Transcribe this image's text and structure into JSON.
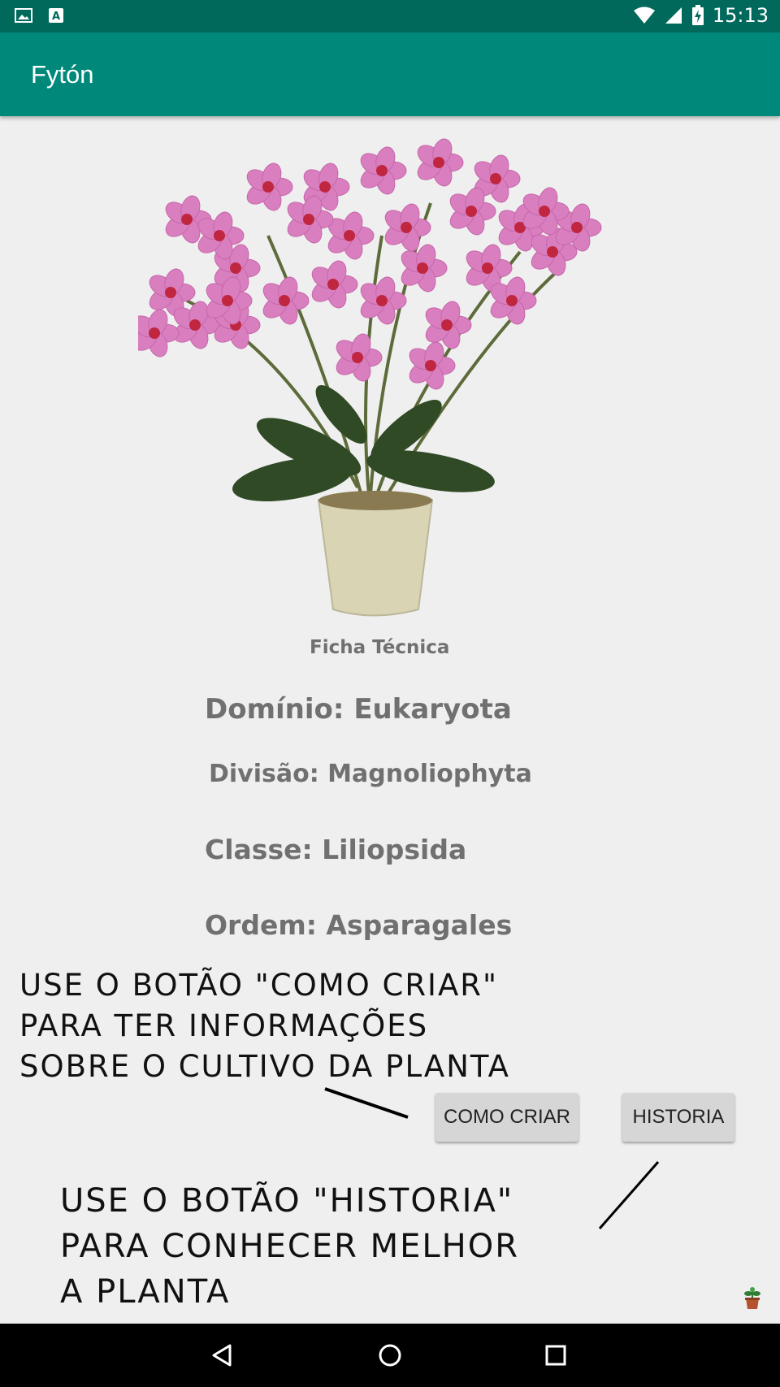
{
  "status_bar": {
    "time": "15:13",
    "left_icons": [
      "image-icon",
      "text-a-icon"
    ],
    "right_icons": [
      "wifi-icon",
      "cellular-signal-icon",
      "battery-icon"
    ]
  },
  "app_bar": {
    "title": "Fytón"
  },
  "plant": {
    "image_icon": "orchid-plant-image",
    "ficha_title": "Ficha Técnica",
    "dominio": "Domínio: Eukaryota",
    "divisao": "Divisão: Magnoliophyta",
    "classe": "Classe: Liliopsida",
    "ordem": "Ordem: Asparagales"
  },
  "annotations": {
    "como_criar": [
      "USE O BOTÃO \"COMO CRIAR\"",
      "PARA TER INFORMAÇÕES",
      "SOBRE O CULTIVO DA PLANTA"
    ],
    "historia": [
      "USE O BOTÃO \"HISTORIA\"",
      "PARA CONHECER MELHOR",
      "A PLANTA"
    ]
  },
  "buttons": {
    "como_criar": "COMO CRIAR",
    "historia": "HISTORIA"
  },
  "nav_bar": {
    "icons": [
      "back-icon",
      "home-icon",
      "recents-icon"
    ]
  },
  "colors": {
    "status_bar": "#00695c",
    "app_bar": "#00897b",
    "background": "#efefef",
    "label_text": "#707070",
    "button_bg": "#d6d6d6"
  }
}
